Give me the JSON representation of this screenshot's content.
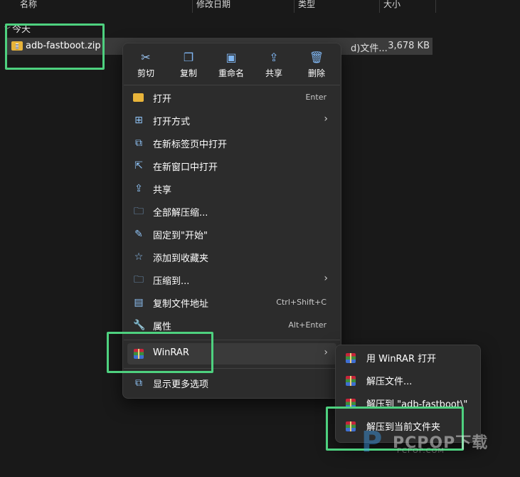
{
  "columns": [
    {
      "label": "名称"
    },
    {
      "label": "修改日期"
    },
    {
      "label": "类型"
    },
    {
      "label": "大小"
    }
  ],
  "group_label": "今天",
  "file": {
    "name": "adb-fastboot.zip",
    "type": "d)文件...",
    "size": "3,678 KB",
    "icon": "zip-folder-icon"
  },
  "quick_actions": [
    {
      "label": "剪切",
      "icon": "scissors-icon"
    },
    {
      "label": "复制",
      "icon": "copy-icon"
    },
    {
      "label": "重命名",
      "icon": "rename-icon"
    },
    {
      "label": "共享",
      "icon": "share-icon"
    },
    {
      "label": "删除",
      "icon": "trash-icon"
    }
  ],
  "menu_items": [
    {
      "label": "打开",
      "shortcut": "Enter",
      "icon": "folder-icon"
    },
    {
      "label": "打开方式",
      "icon": "open-with-icon",
      "submenu": true
    },
    {
      "label": "在新标签页中打开",
      "icon": "new-tab-icon"
    },
    {
      "label": "在新窗口中打开",
      "icon": "new-window-icon"
    },
    {
      "label": "共享",
      "icon": "share-icon"
    },
    {
      "label": "全部解压缩...",
      "icon": "extract-all-icon"
    },
    {
      "label": "固定到\"开始\"",
      "icon": "pin-icon"
    },
    {
      "label": "添加到收藏夹",
      "icon": "star-icon"
    },
    {
      "label": "压缩到...",
      "icon": "compress-icon",
      "submenu": true
    },
    {
      "label": "复制文件地址",
      "shortcut": "Ctrl+Shift+C",
      "icon": "copy-path-icon"
    },
    {
      "label": "属性",
      "shortcut": "Alt+Enter",
      "icon": "wrench-icon"
    }
  ],
  "winrar_item": {
    "label": "WinRAR",
    "icon": "winrar-icon",
    "submenu": true
  },
  "more_options": {
    "label": "显示更多选项",
    "icon": "more-options-icon"
  },
  "submenu_items": [
    {
      "label": "用 WinRAR 打开"
    },
    {
      "label": "解压文件..."
    },
    {
      "label": "解压到 \"adb-fastboot\\\""
    },
    {
      "label": "解压到当前文件夹"
    }
  ],
  "watermark": {
    "text": "PCPOP下载",
    "sub": "PCPOP.COM"
  },
  "colors": {
    "highlight_frame": "#4ed17f",
    "menu_bg": "#2c2c2c",
    "icon_accent": "#8fc3f6",
    "page_bg": "#191919"
  }
}
